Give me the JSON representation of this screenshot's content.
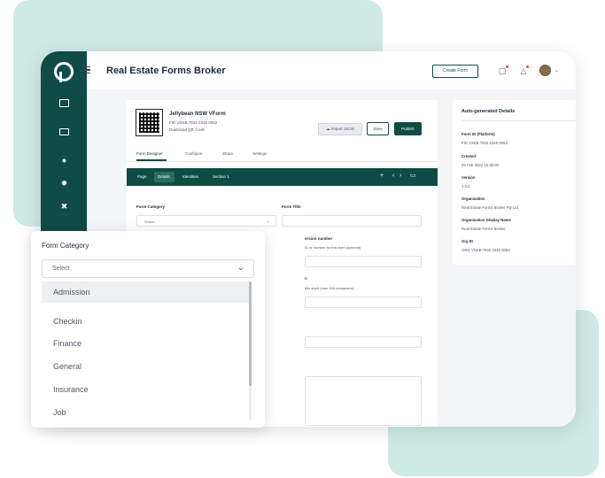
{
  "header": {
    "title": "Real Estate Forms Broker",
    "create_form_label": "Create Form"
  },
  "form": {
    "name": "Jellybean NSW VForm",
    "fid": "FID VXKB 7632 2345 0062",
    "download_qr": "Download QR Code",
    "import_label": "Import JSON",
    "save_label": "Save",
    "publish_label": "Publish"
  },
  "tabs": [
    "Form Designer",
    "Configure",
    "Share",
    "Settings"
  ],
  "designer_bar": {
    "items": [
      "Page",
      "Details",
      "Identities",
      "Section 1"
    ],
    "active": "Details"
  },
  "fields": {
    "form_category_label": "Form Category",
    "form_category_placeholder": "Select",
    "form_title_label": "Form Title",
    "version_label": "ersion number",
    "version_help": "ID or number for this form (optional)",
    "description_help": "this short (max 300 characters)"
  },
  "details": {
    "title": "Auto-generated Details",
    "items": [
      {
        "label": "Form ID (Platform)",
        "value": "FID VXKB 7632 2345 0062"
      },
      {
        "label": "Created",
        "value": "05 Feb 2022 15:35:00"
      },
      {
        "label": "Version",
        "value": "1.0.0"
      },
      {
        "label": "Organisation",
        "value": "Real Estate Forms Broker Pty Ltd"
      },
      {
        "label": "Organisation Display Name",
        "value": "Real Estate Forms Broker"
      },
      {
        "label": "Org ID",
        "value": "ORG VXKB 7632 2345 0062"
      }
    ]
  },
  "dropdown": {
    "label": "Form Category",
    "placeholder": "Select",
    "options": [
      "Admission",
      "Checkin",
      "Finance",
      "General",
      "Insurance",
      "Job"
    ],
    "highlighted": "Admission"
  },
  "colors": {
    "brand": "#0e4c45",
    "background_shape": "#cfe9e4"
  }
}
